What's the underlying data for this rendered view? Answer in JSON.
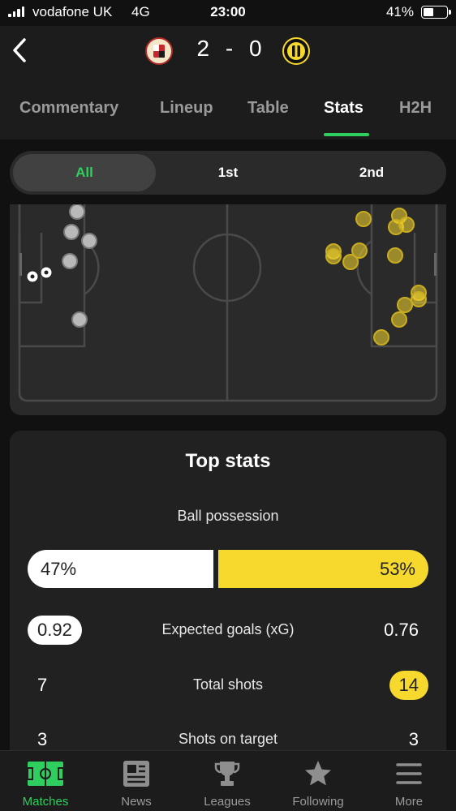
{
  "status_bar": {
    "carrier": "vodafone UK",
    "network": "4G",
    "time": "23:00",
    "battery": "41%"
  },
  "match": {
    "home_crest": "home-team-crest",
    "away_crest": "away-team-crest",
    "home_score": "2",
    "separator": "-",
    "away_score": "0"
  },
  "tabs": [
    {
      "label": "Commentary"
    },
    {
      "label": "Lineup"
    },
    {
      "label": "Table"
    },
    {
      "label": "Stats",
      "active": true
    },
    {
      "label": "H2H"
    }
  ],
  "period_selector": {
    "options": [
      "All",
      "1st",
      "2nd"
    ],
    "selected": "All"
  },
  "shot_map": {
    "home_color": "#bdbdbd",
    "away_color": "#f7d92e",
    "goals": 2
  },
  "top_stats": {
    "title": "Top stats",
    "possession": {
      "label": "Ball possession",
      "home": "47%",
      "away": "53%",
      "home_pct": 47,
      "away_pct": 53
    },
    "rows": [
      {
        "label": "Expected goals (xG)",
        "home": "0.92",
        "away": "0.76",
        "highlight": "home"
      },
      {
        "label": "Total shots",
        "home": "7",
        "away": "14",
        "highlight": "away"
      },
      {
        "label": "Shots on target",
        "home": "3",
        "away": "3",
        "highlight": "none"
      }
    ]
  },
  "bottom_nav": [
    {
      "label": "Matches",
      "icon": "pitch-icon",
      "active": true
    },
    {
      "label": "News",
      "icon": "newspaper-icon"
    },
    {
      "label": "Leagues",
      "icon": "trophy-icon"
    },
    {
      "label": "Following",
      "icon": "star-icon"
    },
    {
      "label": "More",
      "icon": "menu-icon"
    }
  ],
  "colors": {
    "accent": "#2fcf5f",
    "away": "#f7d92e",
    "background": "#111111"
  }
}
